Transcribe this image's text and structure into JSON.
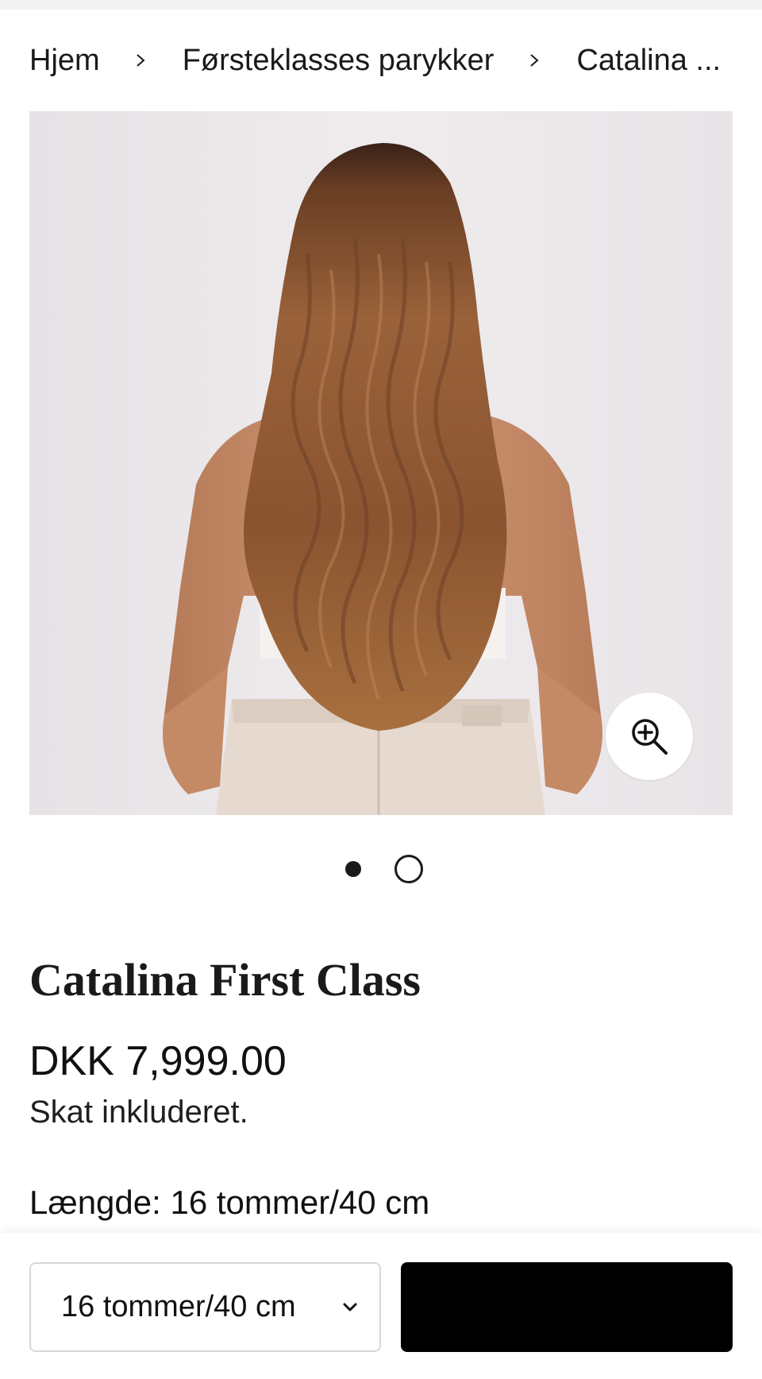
{
  "breadcrumb": {
    "home": "Hjem",
    "category": "Førsteklasses parykker",
    "current": "Catalina ..."
  },
  "gallery": {
    "image_alt": "",
    "slide_count": 2,
    "active_slide": 1,
    "zoom_icon": "zoom-in-icon"
  },
  "product": {
    "title": "Catalina First Class",
    "price": "DKK 7,999.00",
    "tax_note": "Skat inkluderet.",
    "option_label": "Længde:",
    "option_value": "16 tommer/40 cm"
  },
  "sticky_bar": {
    "select_value": "16 tommer/40 cm",
    "add_button_label": ""
  },
  "colors": {
    "text": "#1a1a1a",
    "button": "#000000",
    "photo_background": "#ebe7ea",
    "hair": "#8a5430"
  }
}
